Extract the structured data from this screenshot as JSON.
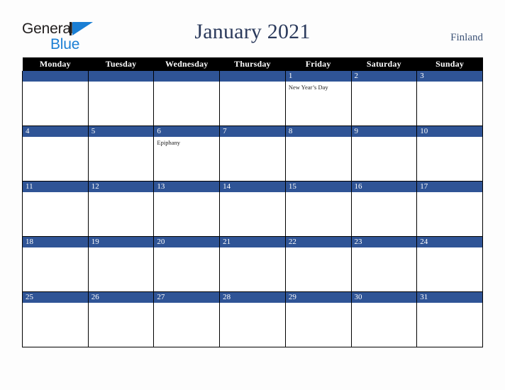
{
  "brand": {
    "name_part1": "General",
    "name_part2": "Blue",
    "mark": "triangle-logo-icon",
    "color_dark": "#221f1f",
    "color_blue": "#1b7fd4"
  },
  "header": {
    "title": "January 2021",
    "country": "Finland",
    "title_color": "#2b3a5c"
  },
  "calendar": {
    "accent_color": "#2f5496",
    "header_bg": "#000000",
    "weekday_headers": [
      "Monday",
      "Tuesday",
      "Wednesday",
      "Thursday",
      "Friday",
      "Saturday",
      "Sunday"
    ],
    "weeks": [
      [
        {
          "num": "",
          "event": ""
        },
        {
          "num": "",
          "event": ""
        },
        {
          "num": "",
          "event": ""
        },
        {
          "num": "",
          "event": ""
        },
        {
          "num": "1",
          "event": "New Year’s Day"
        },
        {
          "num": "2",
          "event": ""
        },
        {
          "num": "3",
          "event": ""
        }
      ],
      [
        {
          "num": "4",
          "event": ""
        },
        {
          "num": "5",
          "event": ""
        },
        {
          "num": "6",
          "event": "Epiphany"
        },
        {
          "num": "7",
          "event": ""
        },
        {
          "num": "8",
          "event": ""
        },
        {
          "num": "9",
          "event": ""
        },
        {
          "num": "10",
          "event": ""
        }
      ],
      [
        {
          "num": "11",
          "event": ""
        },
        {
          "num": "12",
          "event": ""
        },
        {
          "num": "13",
          "event": ""
        },
        {
          "num": "14",
          "event": ""
        },
        {
          "num": "15",
          "event": ""
        },
        {
          "num": "16",
          "event": ""
        },
        {
          "num": "17",
          "event": ""
        }
      ],
      [
        {
          "num": "18",
          "event": ""
        },
        {
          "num": "19",
          "event": ""
        },
        {
          "num": "20",
          "event": ""
        },
        {
          "num": "21",
          "event": ""
        },
        {
          "num": "22",
          "event": ""
        },
        {
          "num": "23",
          "event": ""
        },
        {
          "num": "24",
          "event": ""
        }
      ],
      [
        {
          "num": "25",
          "event": ""
        },
        {
          "num": "26",
          "event": ""
        },
        {
          "num": "27",
          "event": ""
        },
        {
          "num": "28",
          "event": ""
        },
        {
          "num": "29",
          "event": ""
        },
        {
          "num": "30",
          "event": ""
        },
        {
          "num": "31",
          "event": ""
        }
      ]
    ]
  }
}
